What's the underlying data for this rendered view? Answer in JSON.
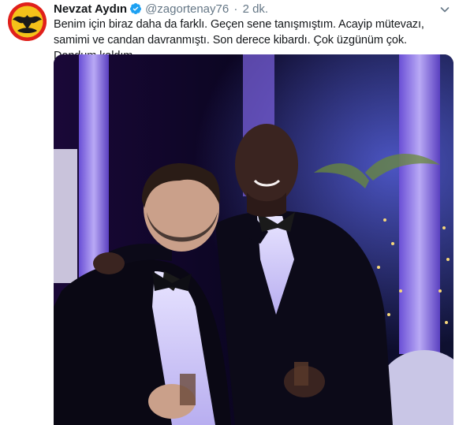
{
  "tweet": {
    "author_name": "Nevzat Aydın",
    "handle": "@zagortenay76",
    "separator": "·",
    "time": "2 dk.",
    "text": "Benim için biraz daha da farklı. Geçen sene tanışmıştım. Acayip mütevazı, samimi ve candan davranmıştı. Son derece kibardı. Çok üzgünüm çok. Dondum kaldım.",
    "verified": true
  },
  "colors": {
    "name": "#14171a",
    "meta": "#657786",
    "verified": "#1da1f2",
    "avatar": "#e0201b"
  },
  "icons": {
    "avatar": "avatar-logo-icon",
    "verified": "verified-badge-icon",
    "caret": "chevron-down-icon"
  }
}
